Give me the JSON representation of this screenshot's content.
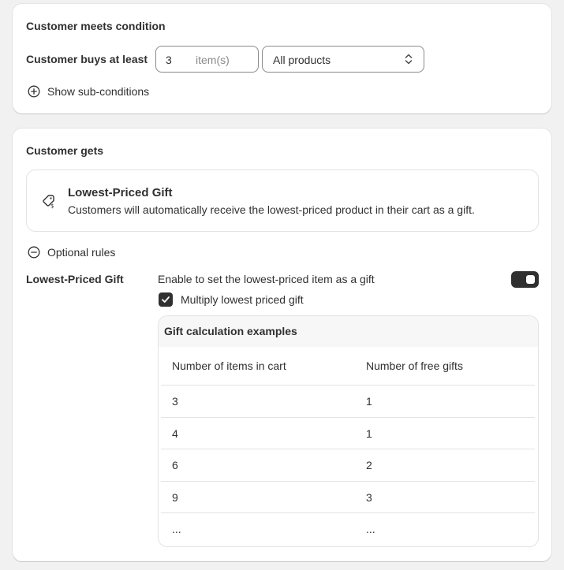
{
  "condition": {
    "title": "Customer meets condition",
    "buys_label": "Customer buys at least",
    "quantity_value": "3",
    "quantity_suffix": "item(s)",
    "products_select": "All products",
    "show_subconditions": "Show sub-conditions"
  },
  "gets": {
    "title": "Customer gets",
    "gift_title": "Lowest-Priced Gift",
    "gift_description": "Customers will automatically receive the lowest-priced product in their cart as a gift.",
    "optional_rules": "Optional rules",
    "rule_label": "Lowest-Priced Gift",
    "enable_text": "Enable to set the lowest-priced item as a gift",
    "toggle_on": true,
    "multiply_label": "Multiply lowest priced gift",
    "multiply_checked": true
  },
  "table": {
    "title": "Gift calculation examples",
    "headers": [
      "Number of items in cart",
      "Number of free gifts"
    ],
    "rows": [
      [
        "3",
        "1"
      ],
      [
        "4",
        "1"
      ],
      [
        "6",
        "2"
      ],
      [
        "9",
        "3"
      ],
      [
        "...",
        "..."
      ]
    ]
  },
  "colors": {
    "background": "#f1f1f1",
    "card": "#ffffff",
    "text": "#303030",
    "toggle": "#303030"
  },
  "icons": {
    "show_subconditions": "plus-circle-icon",
    "optional_rules": "minus-circle-icon",
    "gift": "price-tag-gift-icon",
    "select": "chevron-up-down-icon",
    "checkbox": "checkmark-icon"
  }
}
